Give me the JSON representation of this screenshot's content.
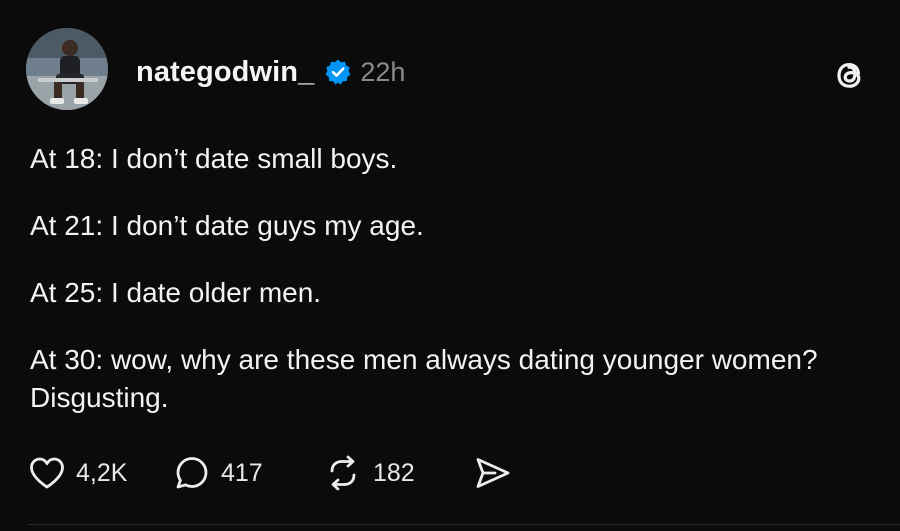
{
  "post": {
    "username": "nategodwin_",
    "verified": true,
    "time": "22h",
    "lines": [
      "At 18: I don’t date small boys.",
      "At 21: I don’t date guys my age.",
      "At 25: I date older men.",
      "At 30: wow, why are these men always dating younger women? Disgusting."
    ],
    "actions": {
      "likes": "4,2K",
      "replies": "417",
      "reposts": "182"
    }
  },
  "icons": {
    "verified": "verified-badge-icon",
    "threads": "threads-logo-icon",
    "like": "heart-icon",
    "reply": "speech-bubble-icon",
    "repost": "repost-icon",
    "share": "send-icon"
  },
  "colors": {
    "background": "#0b0b0c",
    "text": "#f3f3f3",
    "muted": "#8a8a8a",
    "verified": "#0095f6"
  }
}
